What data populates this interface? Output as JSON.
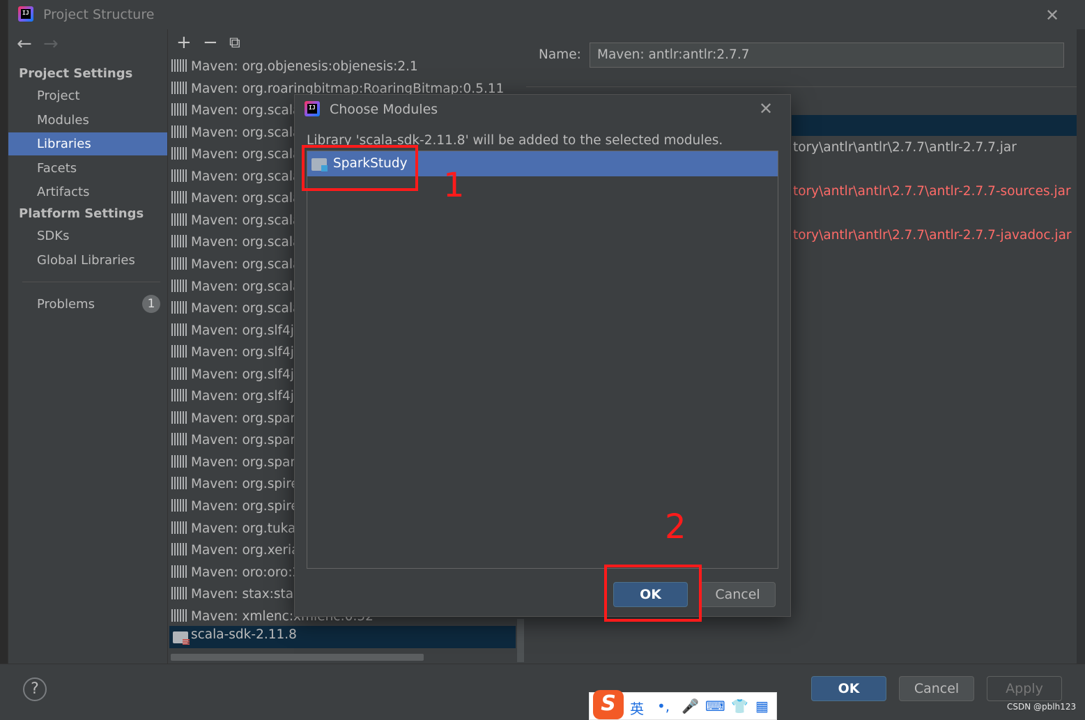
{
  "window": {
    "title": "Project Structure",
    "app_logo_text": "IJ"
  },
  "nav": {
    "back_glyph": "←",
    "forward_glyph": "→",
    "project_settings_header": "Project Settings",
    "project_items": [
      "Project",
      "Modules",
      "Libraries",
      "Facets",
      "Artifacts"
    ],
    "selected_item": "Libraries",
    "platform_settings_header": "Platform Settings",
    "platform_items": [
      "SDKs",
      "Global Libraries"
    ],
    "problems_label": "Problems",
    "problems_count": "1"
  },
  "toolbar": {
    "add_glyph": "+",
    "remove_glyph": "−",
    "copy_glyph": "⧉"
  },
  "libraries": [
    "Maven: org.objenesis:objenesis:2.1",
    "Maven: org.roaringbitmap:RoaringBitmap:0.5.11",
    "Maven: org.scala-",
    "Maven: org.scala-",
    "Maven: org.scala-",
    "Maven: org.scala-",
    "Maven: org.scala-",
    "Maven: org.scala-",
    "Maven: org.scala-",
    "Maven: org.scala-",
    "Maven: org.scalar",
    "Maven: org.scalar",
    "Maven: org.slf4j:j",
    "Maven: org.slf4j:ju",
    "Maven: org.slf4j:s",
    "Maven: org.slf4j:s",
    "Maven: org.spark",
    "Maven: org.spark",
    "Maven: org.spark",
    "Maven: org.spire-",
    "Maven: org.spire-",
    "Maven: org.tukaa",
    "Maven: org.xerial",
    "Maven: oro:oro:2.",
    "Maven: stax:stax-",
    "Maven: xmlenc:xmlenc:0.52"
  ],
  "selected_library": "scala-sdk-2.11.8",
  "detail": {
    "name_label": "Name:",
    "name_value": "Maven: antlr:antlr:2.7.7",
    "paths": [
      {
        "text": "tory\\antlr\\antlr\\2.7.7\\antlr-2.7.7.jar",
        "color": "#bbbbbb"
      },
      {
        "text": "tory\\antlr\\antlr\\2.7.7\\antlr-2.7.7-sources.jar",
        "color": "#ff6b68"
      },
      {
        "text": "tory\\antlr\\antlr\\2.7.7\\antlr-2.7.7-javadoc.jar",
        "color": "#ff6b68"
      }
    ]
  },
  "dialog": {
    "title": "Choose Modules",
    "message": "Library 'scala-sdk-2.11.8' will be added to the selected modules.",
    "module": "SparkStudy",
    "ok": "OK",
    "cancel": "Cancel"
  },
  "annotations": {
    "num1": "1",
    "num2": "2",
    "color": "#ff1b1b"
  },
  "buttons": {
    "help": "?",
    "ok": "OK",
    "cancel": "Cancel",
    "apply": "Apply"
  },
  "ime": {
    "logo": "S",
    "lang": "英",
    "punct": "•,",
    "mic": "🎤",
    "keyboard": "⌨",
    "skin": "👕",
    "apps": "▦"
  },
  "watermark": "CSDN @pblh123"
}
